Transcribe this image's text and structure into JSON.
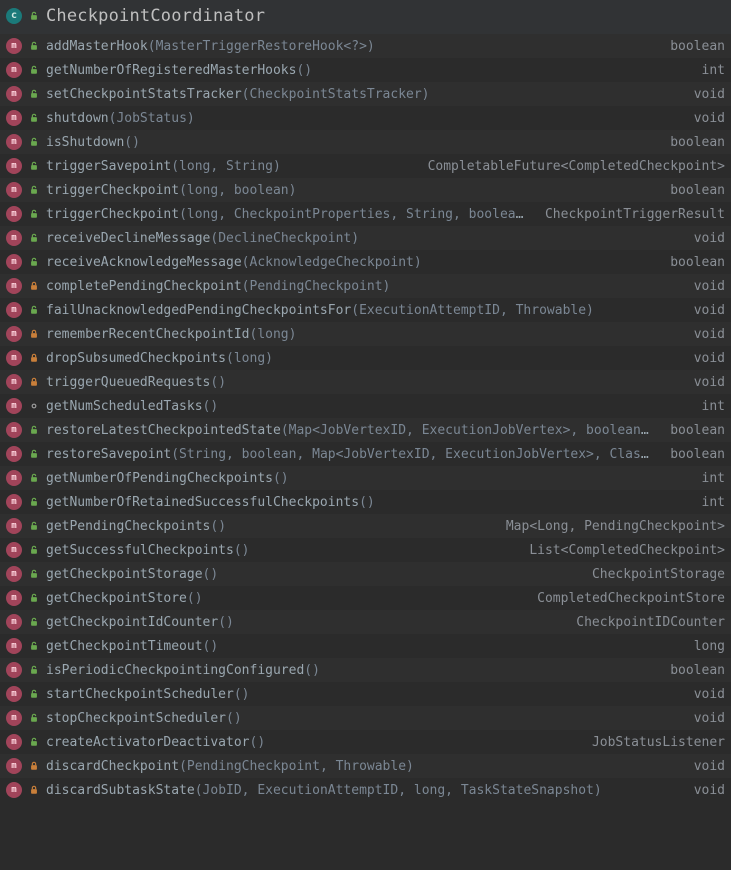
{
  "header": {
    "class_icon_letter": "c",
    "title": "CheckpointCoordinator"
  },
  "visibility_colors": {
    "public": "#6aa84f",
    "private": "#c97f3a",
    "package": "#9e9e9e"
  },
  "methods": [
    {
      "vis": "public",
      "name": "addMasterHook",
      "params": "(MasterTriggerRestoreHook<?>)",
      "ret": "boolean"
    },
    {
      "vis": "public",
      "name": "getNumberOfRegisteredMasterHooks",
      "params": "()",
      "ret": "int"
    },
    {
      "vis": "public",
      "name": "setCheckpointStatsTracker",
      "params": "(CheckpointStatsTracker)",
      "ret": "void"
    },
    {
      "vis": "public",
      "name": "shutdown",
      "params": "(JobStatus)",
      "ret": "void"
    },
    {
      "vis": "public",
      "name": "isShutdown",
      "params": "()",
      "ret": "boolean"
    },
    {
      "vis": "public",
      "name": "triggerSavepoint",
      "params": "(long, String)",
      "ret": "CompletableFuture<CompletedCheckpoint>"
    },
    {
      "vis": "public",
      "name": "triggerCheckpoint",
      "params": "(long, boolean)",
      "ret": "boolean"
    },
    {
      "vis": "public",
      "name": "triggerCheckpoint",
      "params": "(long, CheckpointProperties, String, boolean)",
      "ret": "CheckpointTriggerResult"
    },
    {
      "vis": "public",
      "name": "receiveDeclineMessage",
      "params": "(DeclineCheckpoint)",
      "ret": "void"
    },
    {
      "vis": "public",
      "name": "receiveAcknowledgeMessage",
      "params": "(AcknowledgeCheckpoint)",
      "ret": "boolean"
    },
    {
      "vis": "private",
      "name": "completePendingCheckpoint",
      "params": "(PendingCheckpoint)",
      "ret": "void"
    },
    {
      "vis": "public",
      "name": "failUnacknowledgedPendingCheckpointsFor",
      "params": "(ExecutionAttemptID, Throwable)",
      "ret": "void"
    },
    {
      "vis": "private",
      "name": "rememberRecentCheckpointId",
      "params": "(long)",
      "ret": "void"
    },
    {
      "vis": "private",
      "name": "dropSubsumedCheckpoints",
      "params": "(long)",
      "ret": "void"
    },
    {
      "vis": "private",
      "name": "triggerQueuedRequests",
      "params": "()",
      "ret": "void"
    },
    {
      "vis": "package",
      "name": "getNumScheduledTasks",
      "params": "()",
      "ret": "int"
    },
    {
      "vis": "public",
      "name": "restoreLatestCheckpointedState",
      "params": "(Map<JobVertexID, ExecutionJobVertex>, boolean, boolean)",
      "ret": "boolean"
    },
    {
      "vis": "public",
      "name": "restoreSavepoint",
      "params": "(String, boolean, Map<JobVertexID, ExecutionJobVertex>, ClassLoader)",
      "ret": "boolean"
    },
    {
      "vis": "public",
      "name": "getNumberOfPendingCheckpoints",
      "params": "()",
      "ret": "int"
    },
    {
      "vis": "public",
      "name": "getNumberOfRetainedSuccessfulCheckpoints",
      "params": "()",
      "ret": "int"
    },
    {
      "vis": "public",
      "name": "getPendingCheckpoints",
      "params": "()",
      "ret": "Map<Long, PendingCheckpoint>"
    },
    {
      "vis": "public",
      "name": "getSuccessfulCheckpoints",
      "params": "()",
      "ret": "List<CompletedCheckpoint>"
    },
    {
      "vis": "public",
      "name": "getCheckpointStorage",
      "params": "()",
      "ret": "CheckpointStorage"
    },
    {
      "vis": "public",
      "name": "getCheckpointStore",
      "params": "()",
      "ret": "CompletedCheckpointStore"
    },
    {
      "vis": "public",
      "name": "getCheckpointIdCounter",
      "params": "()",
      "ret": "CheckpointIDCounter"
    },
    {
      "vis": "public",
      "name": "getCheckpointTimeout",
      "params": "()",
      "ret": "long"
    },
    {
      "vis": "public",
      "name": "isPeriodicCheckpointingConfigured",
      "params": "()",
      "ret": "boolean"
    },
    {
      "vis": "public",
      "name": "startCheckpointScheduler",
      "params": "()",
      "ret": "void"
    },
    {
      "vis": "public",
      "name": "stopCheckpointScheduler",
      "params": "()",
      "ret": "void"
    },
    {
      "vis": "public",
      "name": "createActivatorDeactivator",
      "params": "()",
      "ret": "JobStatusListener"
    },
    {
      "vis": "private",
      "name": "discardCheckpoint",
      "params": "(PendingCheckpoint, Throwable)",
      "ret": "void"
    },
    {
      "vis": "private",
      "name": "discardSubtaskState",
      "params": "(JobID, ExecutionAttemptID, long, TaskStateSnapshot)",
      "ret": "void"
    }
  ]
}
